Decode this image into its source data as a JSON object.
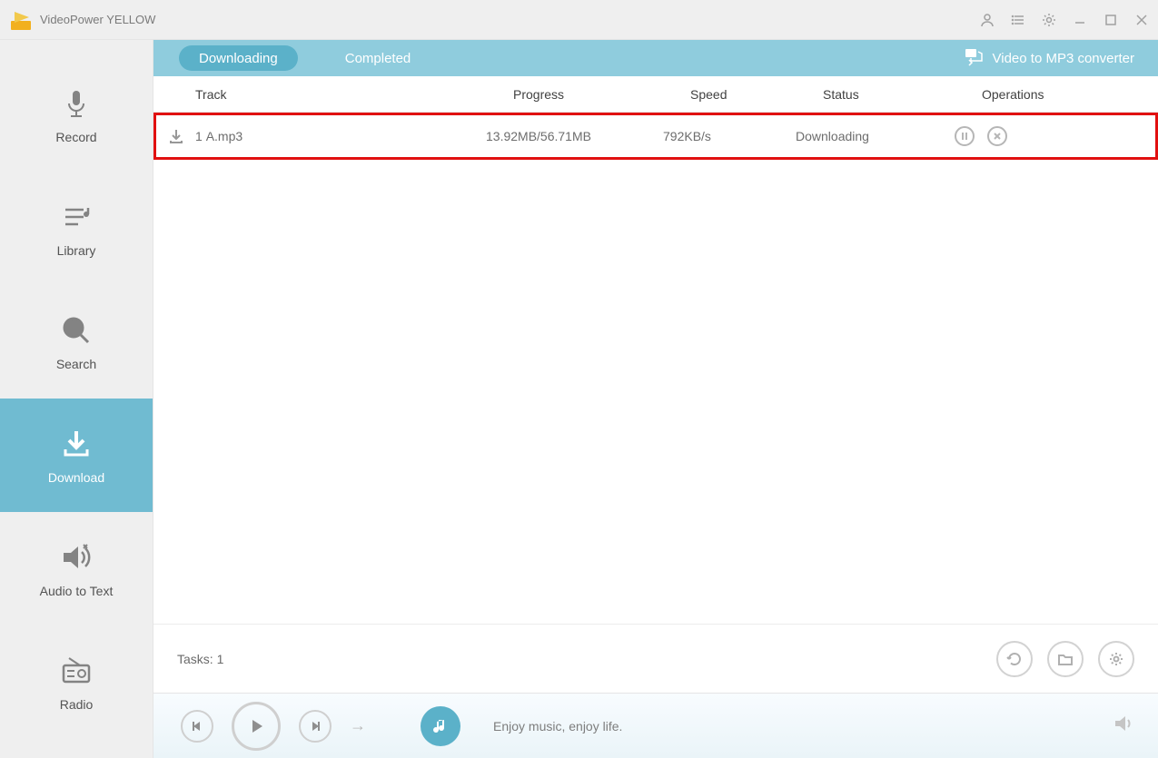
{
  "app": {
    "title": "VideoPower YELLOW"
  },
  "sidebar": {
    "items": [
      {
        "label": "Record"
      },
      {
        "label": "Library"
      },
      {
        "label": "Search"
      },
      {
        "label": "Download"
      },
      {
        "label": "Audio to Text"
      },
      {
        "label": "Radio"
      }
    ]
  },
  "tabs": {
    "downloading": "Downloading",
    "completed": "Completed",
    "converter": "Video to MP3 converter"
  },
  "columns": {
    "track": "Track",
    "progress": "Progress",
    "speed": "Speed",
    "status": "Status",
    "operations": "Operations"
  },
  "downloads": [
    {
      "index": "1",
      "name": "A.mp3",
      "progress": "13.92MB/56.71MB",
      "speed": "792KB/s",
      "status": "Downloading"
    }
  ],
  "status": {
    "tasks_label": "Tasks: 1"
  },
  "player": {
    "song": "Enjoy music, enjoy life."
  }
}
